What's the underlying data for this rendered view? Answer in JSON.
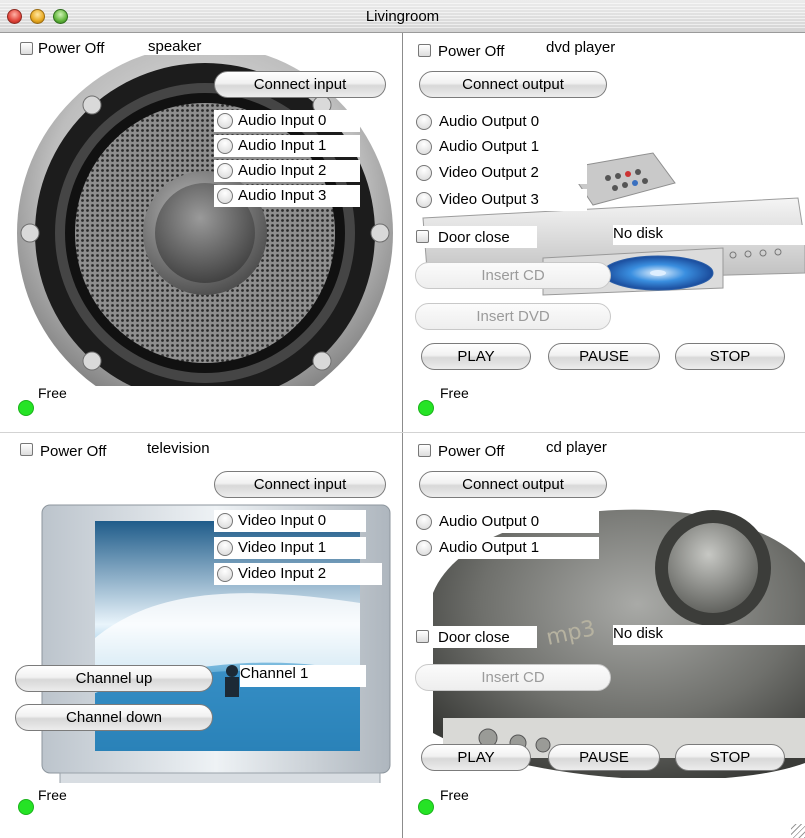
{
  "window": {
    "title": "Livingroom"
  },
  "speaker": {
    "power_label": "Power Off",
    "device_name": "speaker",
    "connect_label": "Connect input",
    "inputs": [
      "Audio Input 0",
      "Audio Input 1",
      "Audio Input 2",
      "Audio Input 3"
    ],
    "status": "Free"
  },
  "dvd": {
    "power_label": "Power Off",
    "device_name": "dvd player",
    "connect_label": "Connect output",
    "outputs": [
      "Audio Output 0",
      "Audio Output 1",
      "Video Output 2",
      "Video Output 3"
    ],
    "door_label": "Door close",
    "disk_status": "No disk",
    "insert_cd_label": "Insert CD",
    "insert_dvd_label": "Insert DVD",
    "play_label": "PLAY",
    "pause_label": "PAUSE",
    "stop_label": "STOP",
    "status": "Free"
  },
  "tv": {
    "power_label": "Power Off",
    "device_name": "television",
    "connect_label": "Connect input",
    "inputs": [
      "Video Input 0",
      "Video Input 1",
      "Video Input 2"
    ],
    "channel_up_label": "Channel up",
    "channel_down_label": "Channel down",
    "channel_value": "Channel 1",
    "status": "Free"
  },
  "cd": {
    "power_label": "Power Off",
    "device_name": "cd player",
    "connect_label": "Connect output",
    "outputs": [
      "Audio Output 0",
      "Audio Output 1"
    ],
    "door_label": "Door close",
    "disk_status": "No disk",
    "insert_cd_label": "Insert CD",
    "play_label": "PLAY",
    "pause_label": "PAUSE",
    "stop_label": "STOP",
    "status": "Free"
  },
  "colors": {
    "status_free": "#25e325"
  }
}
